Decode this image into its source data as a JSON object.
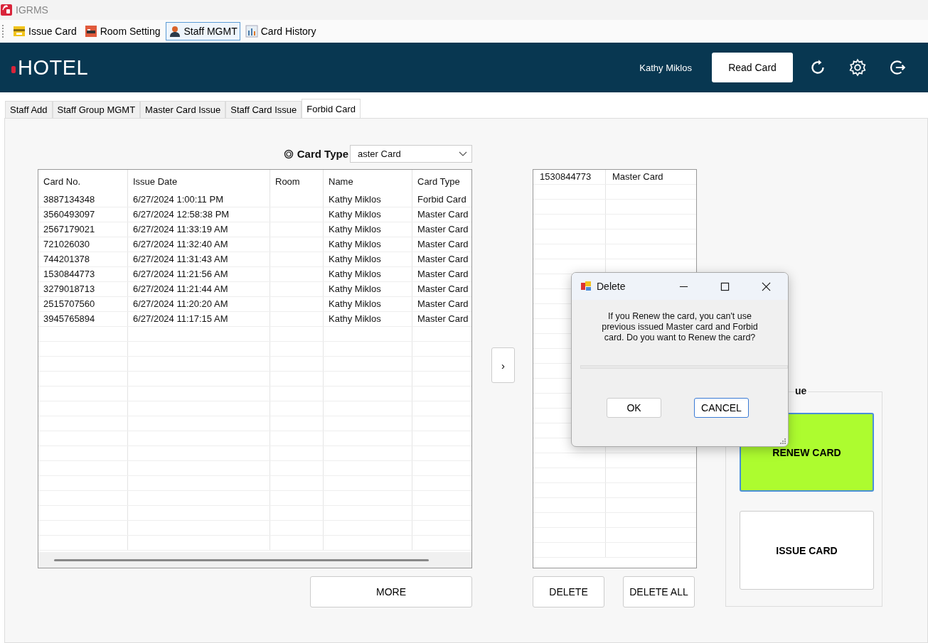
{
  "window": {
    "title": "IGRMS"
  },
  "toolbar": [
    {
      "label": "Issue Card",
      "selected": false
    },
    {
      "label": "Room Setting",
      "selected": false
    },
    {
      "label": "Staff MGMT",
      "selected": true
    },
    {
      "label": "Card History",
      "selected": false
    }
  ],
  "header": {
    "logo": "HOTEL",
    "user": "Kathy Miklos",
    "read_button": "Read Card"
  },
  "tabs": [
    {
      "label": "Staff Add",
      "selected": false
    },
    {
      "label": "Staff Group MGMT",
      "selected": false
    },
    {
      "label": "Master Card Issue",
      "selected": false
    },
    {
      "label": "Staff Card Issue",
      "selected": false
    },
    {
      "label": "Forbid Card",
      "selected": true
    }
  ],
  "card_type": {
    "label": "Card Type",
    "value": "aster Card"
  },
  "table": {
    "columns": [
      "Card No.",
      "Issue Date",
      "Room",
      "Name",
      "Card Type"
    ],
    "rows": [
      [
        "3887134348",
        "6/27/2024 1:00:11 PM",
        "",
        "Kathy Miklos",
        "Forbid Card"
      ],
      [
        "3560493097",
        "6/27/2024 12:58:38 PM",
        "",
        "Kathy Miklos",
        "Master Card"
      ],
      [
        "2567179021",
        "6/27/2024 11:33:19 AM",
        "",
        "Kathy Miklos",
        "Master Card"
      ],
      [
        "721026030",
        "6/27/2024 11:32:40 AM",
        "",
        "Kathy Miklos",
        "Master Card"
      ],
      [
        "744201378",
        "6/27/2024 11:31:43 AM",
        "",
        "Kathy Miklos",
        "Master Card"
      ],
      [
        "1530844773",
        "6/27/2024 11:21:56 AM",
        "",
        "Kathy Miklos",
        "Master Card"
      ],
      [
        "3279018713",
        "6/27/2024 11:21:44 AM",
        "",
        "Kathy Miklos",
        "Master Card"
      ],
      [
        "2515707560",
        "6/27/2024 11:20:20 AM",
        "",
        "Kathy Miklos",
        "Master Card"
      ],
      [
        "3945765894",
        "6/27/2024 11:17:15 AM",
        "",
        "Kathy Miklos",
        "Master Card"
      ]
    ]
  },
  "more_button": "MORE",
  "move_button": "›",
  "selected_table": {
    "rows": [
      [
        "1530844773",
        "Master Card"
      ]
    ]
  },
  "delete_button": "DELETE",
  "delete_all_button": "DELETE ALL",
  "issue_group": {
    "legend": "ue",
    "buttons": [
      {
        "label": "RENEW CARD",
        "selected": true
      },
      {
        "label": "ISSUE CARD",
        "selected": false
      }
    ]
  },
  "dialog": {
    "title": "Delete",
    "message": "If you Renew the card, you can't use previous issued Master card and Forbid card. Do you want to Renew the card?",
    "buttons": [
      {
        "label": "OK",
        "selected": false
      },
      {
        "label": "CANCEL",
        "selected": true
      }
    ]
  }
}
